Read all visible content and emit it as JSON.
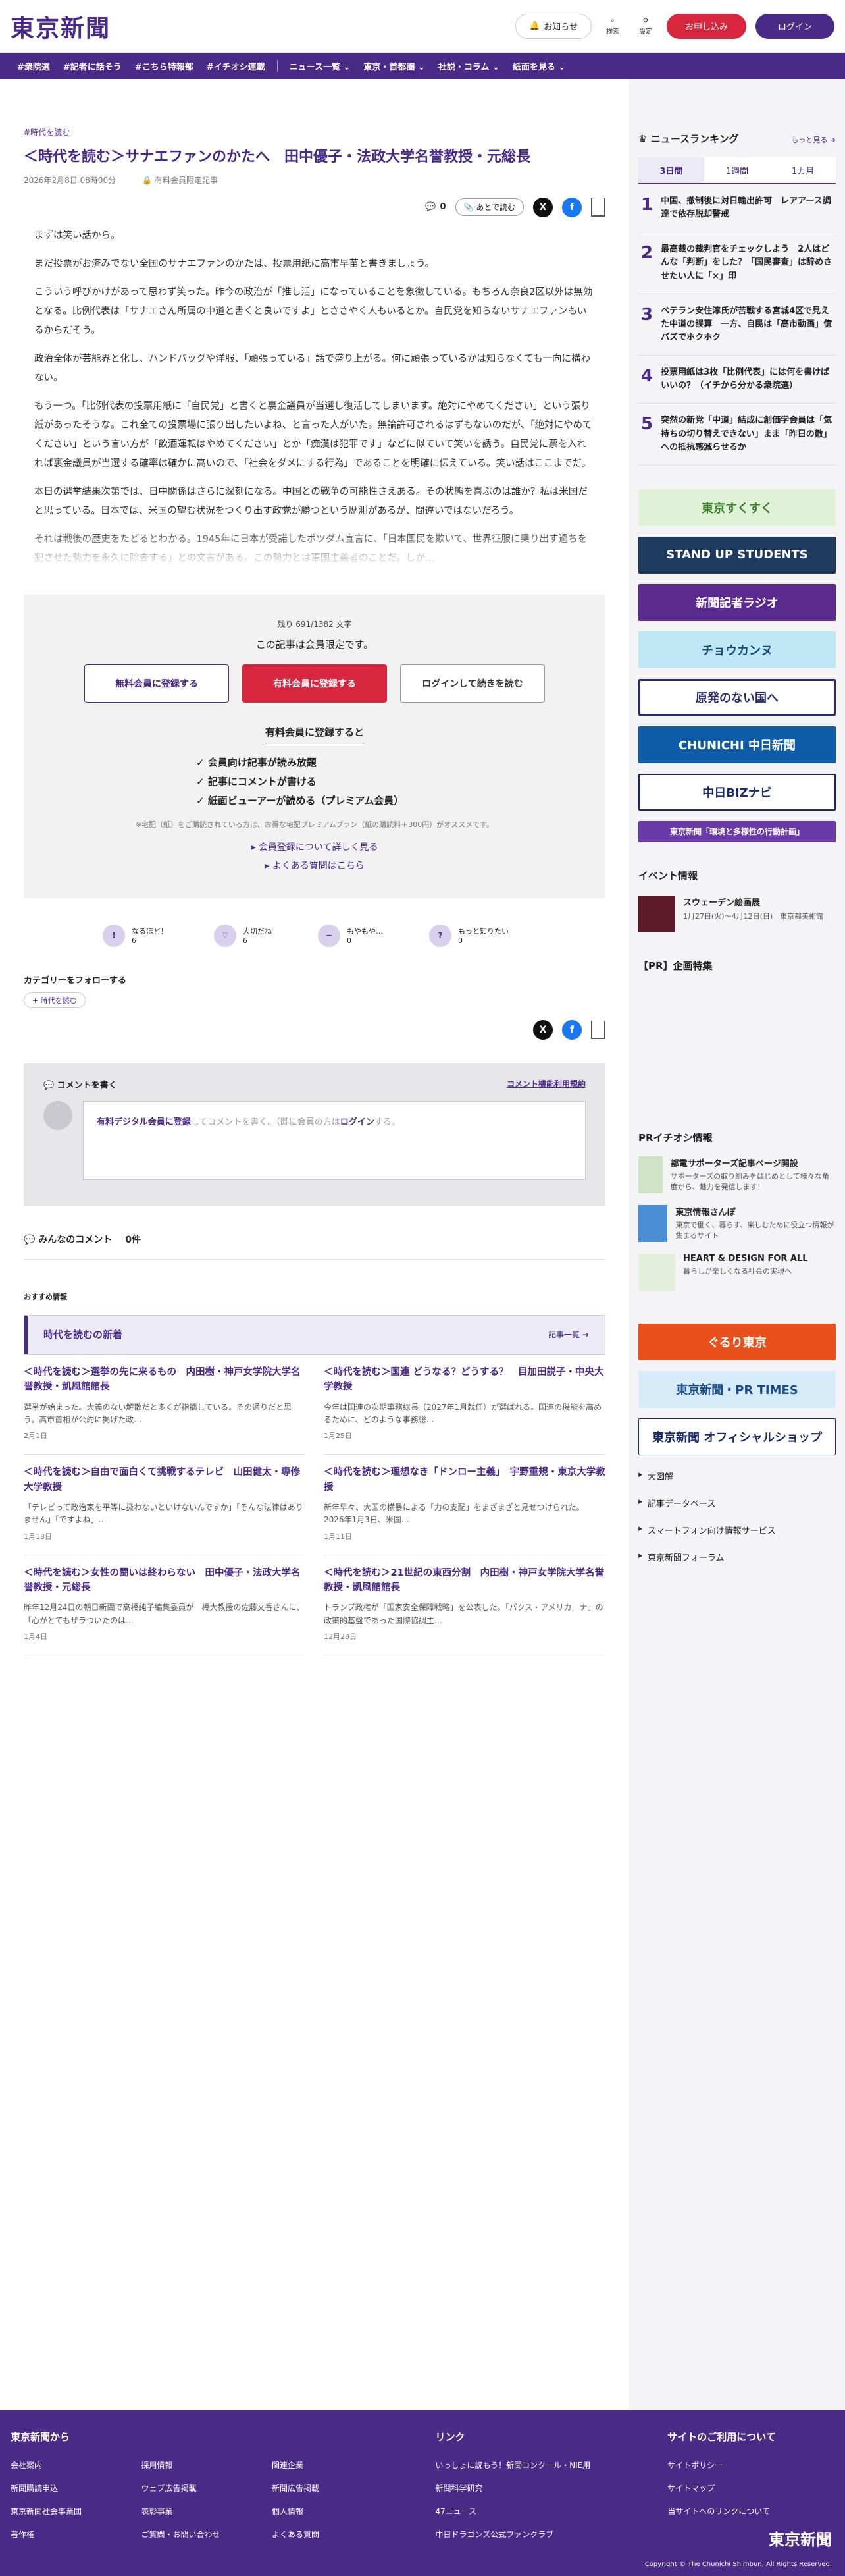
{
  "header": {
    "logo": "東京新聞",
    "notice": "お知らせ",
    "search": "検索",
    "settings": "設定",
    "trial": "お申し込み",
    "login": "ログイン"
  },
  "nav": [
    "#衆院選",
    "#記者に話そう",
    "#こちら特報部",
    "#イチオシ連載",
    "ニュース一覧 ⌄",
    "東京・首都圏 ⌄",
    "社説・コラム ⌄",
    "紙面を見る ⌄"
  ],
  "article": {
    "category": "#時代を読む",
    "title": "＜時代を読む＞サナエファンのかたへ　田中優子・法政大学名誉教授・元総長",
    "date": "2026年2月8日 08時00分",
    "member_only": "有料会員限定記事",
    "comment_count": "0",
    "read_later": "あとで読む",
    "paragraphs": [
      "まずは笑い話から。",
      "まだ投票がお済みでない全国のサナエファンのかたは、投票用紙に高市早苗と書きましょう。",
      "こういう呼びかけがあって思わず笑った。昨今の政治が「推し活」になっていることを象徴している。もちろん奈良2区以外は無効となる。比例代表は「サナエさん所属の中道と書くと良いですよ」とささやく人もいるとか。自民党を知らないサナエファンもいるからだそう。",
      "政治全体が芸能界と化し、ハンドバッグや洋服、「頑張っている」話で盛り上がる。何に頑張っているかは知らなくても一向に構わない。",
      "もう一つ。「比例代表の投票用紙に「自民党」と書くと裏金議員が当選し復活してしまいます。絶対にやめてください」という張り紙があったそうな。これ全ての投票場に張り出したいよね、と言った人がいた。無論許可されるはずもないのだが、「絶対にやめてください」という言い方が「飲酒運転はやめてください」とか「痴漢は犯罪です」などに似ていて笑いを誘う。自民党に票を入れれば裏金議員が当選する確率は確かに高いので、「社会をダメにする行為」であることを明確に伝えている。笑い話はここまでだ。",
      "本日の選挙結果次第では、日中関係はさらに深刻になる。中国との戦争の可能性さえある。その状態を喜ぶのは誰か？私は米国だと思っている。日本では、米国の望む状況をつくり出す政党が勝つという歴測があるが、間違いではないだろう。",
      "それは戦後の歴史をたどるとわかる。1945年に日本が受諾したポツダム宣言に、「日本国民を欺いて、世界征服に乗り出す過ちを犯させた勢力を永久に除去する」との文言がある。この勢力とは軍国主義者のことだ。しか…"
    ]
  },
  "paywall": {
    "remaining": "残り 691/1382 文字",
    "message": "この記事は会員限定です。",
    "btn_free": "無料会員に登録する",
    "btn_paid": "有料会員に登録する",
    "btn_login": "ログインして続きを読む",
    "benefits_title": "有料会員に登録すると",
    "benefits": [
      "会員向け記事が読み放題",
      "記事にコメントが書ける",
      "紙面ビューアーが読める（プレミアム会員）"
    ],
    "note": "※宅配（紙）をご購読されている方は、お得な宅配プレミアムプラン（紙の購読料＋300円）がオススメです。",
    "link_more": "会員登録について詳しく見る",
    "link_faq": "よくある質問はこちら"
  },
  "reactions": [
    {
      "label": "なるほど！",
      "count": "6",
      "icon": "!"
    },
    {
      "label": "大切だね",
      "count": "6",
      "icon": "♡"
    },
    {
      "label": "もやもや…",
      "count": "0",
      "icon": "~"
    },
    {
      "label": "もっと知りたい",
      "count": "0",
      "icon": "?"
    }
  ],
  "follow": {
    "label": "カテゴリーをフォローする",
    "tag": "時代を読む"
  },
  "comments": {
    "write": "コメントを書く",
    "rules": "コメント機能利用規約",
    "prompt_link": "有料デジタル会員に登録",
    "prompt_text": "してコメントを書く。（既に会員の方は",
    "prompt_login": "ログイン",
    "prompt_end": "する。",
    "all_label": "みんなのコメント",
    "all_count": "0件"
  },
  "recommend": {
    "label": "おすすめ情報",
    "section_title": "時代を読むの新着",
    "more": "記事一覧 ➔",
    "items": [
      {
        "title": "＜時代を読む＞選挙の先に来るもの　内田樹・神戸女学院大学名誉教授・凱風館館長",
        "desc": "選挙が始まった。大義のない解散だと多くが指摘している。その通りだと思う。高市首相が公約に掲げた政…",
        "date": "2月1日"
      },
      {
        "title": "＜時代を読む＞国連 どうなる？どうする？　目加田説子・中央大学教授",
        "desc": "今年は国連の次期事務総長（2027年1月就任）が選ばれる。国連の機能を高めるために、どのような事務総…",
        "date": "1月25日"
      },
      {
        "title": "＜時代を読む＞自由で面白くて挑戦するテレビ　山田健太・専修大学教授",
        "desc": "「テレビって政治家を平等に扱わないといけないんですか」「そんな法律はありません」「ですよね」…",
        "date": "1月18日"
      },
      {
        "title": "＜時代を読む＞理想なき「ドンロー主義」　宇野重規・東京大学教授",
        "desc": "新年早々、大国の横暴による「力の支配」をまざまざと見せつけられた。　2026年1月3日、米国…",
        "date": "1月11日"
      },
      {
        "title": "＜時代を読む＞女性の闘いは終わらない　田中優子・法政大学名誉教授・元総長",
        "desc": "昨年12月24日の朝日新聞で高橋純子編集委員が一橋大教授の佐藤文香さんに、「心がとてもザラついたのは…",
        "date": "1月4日"
      },
      {
        "title": "＜時代を読む＞21世紀の東西分割　内田樹・神戸女学院大学名誉教授・凱風館館長",
        "desc": "トランプ政権が「国家安全保障戦略」を公表した。「パクス・アメリカーナ」の政策的基盤であった国際協調主…",
        "date": "12月28日"
      }
    ]
  },
  "sidebar": {
    "ranking_title": "ニュースランキング",
    "ranking_more": "もっと見る ➔",
    "tabs": [
      "3日間",
      "1週間",
      "1カ月"
    ],
    "ranking": [
      "中国、撤制後に対日輸出許可　レアアース調達で依存脱却警戒",
      "最高裁の裁判官をチェックしよう　2人はどんな「判断」をした？「国民審査」は辞めさせたい人に「×」印",
      "ベテラン安住淳氏が苦戦する宮城4区で見えた中道の誤算　一方、自民は「高市動画」億バズでホクホク",
      "投票用紙は3枚「比例代表」には何を書けばいいの？（イチから分かる衆院選）",
      "突然の新党「中道」結成に創価学会員は「気持ちの切り替えできない」まま「昨日の敵」への抵抗感減らせるか"
    ],
    "banners": [
      "東京すくすく",
      "STAND UP STUDENTS",
      "新聞記者ラジオ",
      "チョウカンヌ",
      "原発のない国へ",
      "CHUNICHI 中日新聞",
      "中日BIZナビ",
      "東京新聞「環境と多様性の行動計画」"
    ],
    "event_title": "イベント情報",
    "event": {
      "title": "スウェーデン絵画展",
      "date": "1月27日(火)〜4月12日(日)　東京都美術館"
    },
    "pr_title": "【PR】企画特集",
    "ichioshi_title": "PRイチオシ情報",
    "ichioshi": [
      {
        "title": "都電サポーターズ記事ページ開設",
        "desc": "サポーターズの取り組みをはじめとして様々な角度から、魅力を発信します！"
      },
      {
        "title": "東京情報さんぽ",
        "desc": "東京で働く、暮らす、楽しむために役立つ情報が集まるサイト"
      },
      {
        "title": "HEART & DESIGN FOR ALL",
        "desc": "暮らしが楽しくなる社会の実現へ"
      }
    ],
    "bottom_banners": [
      "ぐるり東京",
      "東京新聞・PR TIMES",
      "東京新聞 オフィシャルショップ"
    ],
    "links": [
      "大図解",
      "記事データベース",
      "スマートフォン向け情報サービス",
      "東京新聞フォーラム"
    ]
  },
  "footer": {
    "col1_title": "東京新聞から",
    "col1": [
      "会社案内",
      "採用情報",
      "関連企業",
      "新聞購読申込",
      "ウェブ広告掲載",
      "新聞広告掲載",
      "東京新聞社会事業団",
      "表彰事業",
      "個人情報",
      "著作権",
      "ご質問・お問い合わせ",
      "よくある質問"
    ],
    "col2_title": "リンク",
    "col2": [
      "いっしょに読もう！新聞コンクール・NIE用",
      "新聞科学研究",
      "47ニュース",
      "中日ドラゴンズ公式ファンクラブ"
    ],
    "col3_title": "サイトのご利用について",
    "col3": [
      "サイトポリシー",
      "サイトマップ",
      "当サイトへのリンクについて"
    ],
    "logo": "東京新聞",
    "copyright": "Copyright © The Chunichi Shimbun, All Rights Reserved."
  }
}
